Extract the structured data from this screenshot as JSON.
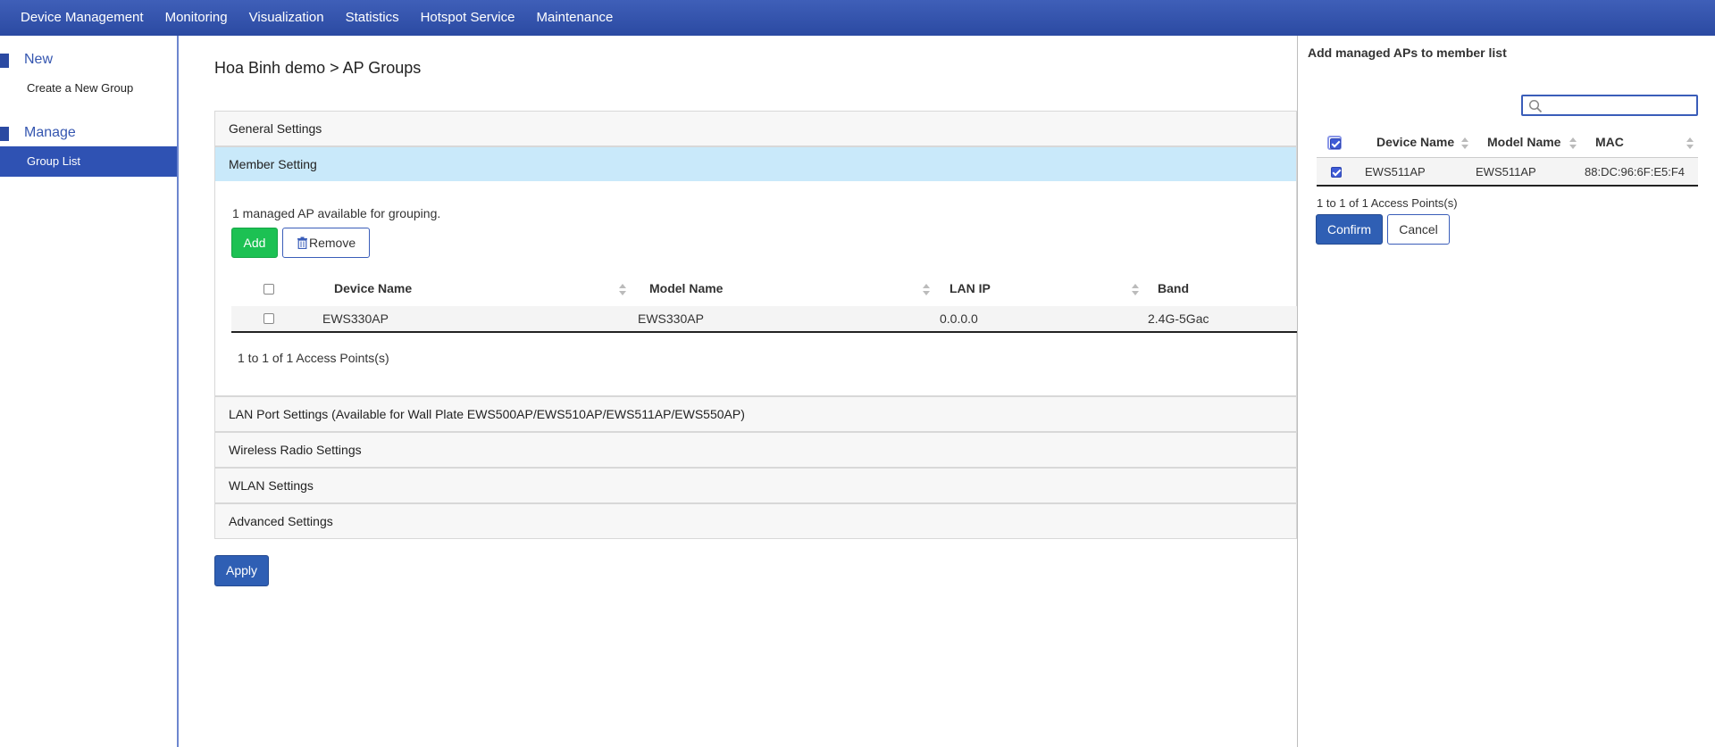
{
  "nav": {
    "items": [
      "Device Management",
      "Monitoring",
      "Visualization",
      "Statistics",
      "Hotspot Service",
      "Maintenance"
    ]
  },
  "sidebar": {
    "new_title": "New",
    "create_group": "Create a New Group",
    "manage_title": "Manage",
    "group_list": "Group List"
  },
  "main": {
    "breadcrumb": "Hoa Binh demo > AP Groups",
    "panels": {
      "general": "General Settings",
      "member": "Member Setting",
      "lan": "LAN Port Settings (Available for Wall Plate EWS500AP/EWS510AP/EWS511AP/EWS550AP)",
      "wireless": "Wireless Radio Settings",
      "wlan": "WLAN Settings",
      "advanced": "Advanced Settings"
    },
    "member": {
      "available_text": "1 managed AP available for grouping.",
      "add_label": "Add",
      "remove_label": "Remove",
      "columns": [
        "Device Name",
        "Model Name",
        "LAN IP",
        "Band"
      ],
      "rows": [
        {
          "device": "EWS330AP",
          "model": "EWS330AP",
          "lan_ip": "0.0.0.0",
          "band": "2.4G-5Gac"
        }
      ],
      "count_text": "1 to 1 of 1 Access Points(s)"
    },
    "apply_label": "Apply"
  },
  "overlay": {
    "title": "Add managed APs to member list",
    "search_placeholder": "",
    "columns": [
      "Device Name",
      "Model Name",
      "MAC"
    ],
    "rows": [
      {
        "device": "EWS511AP",
        "model": "EWS511AP",
        "mac": "88:DC:96:6F:E5:F4",
        "checked": true
      }
    ],
    "count_text": "1 to 1 of 1 Access Points(s)",
    "confirm_label": "Confirm",
    "cancel_label": "Cancel"
  },
  "colors": {
    "nav_bg": "#2b4aa2",
    "accent": "#2f5fb4",
    "add_green": "#1cc153",
    "member_header_bg": "#c9e9fa"
  }
}
